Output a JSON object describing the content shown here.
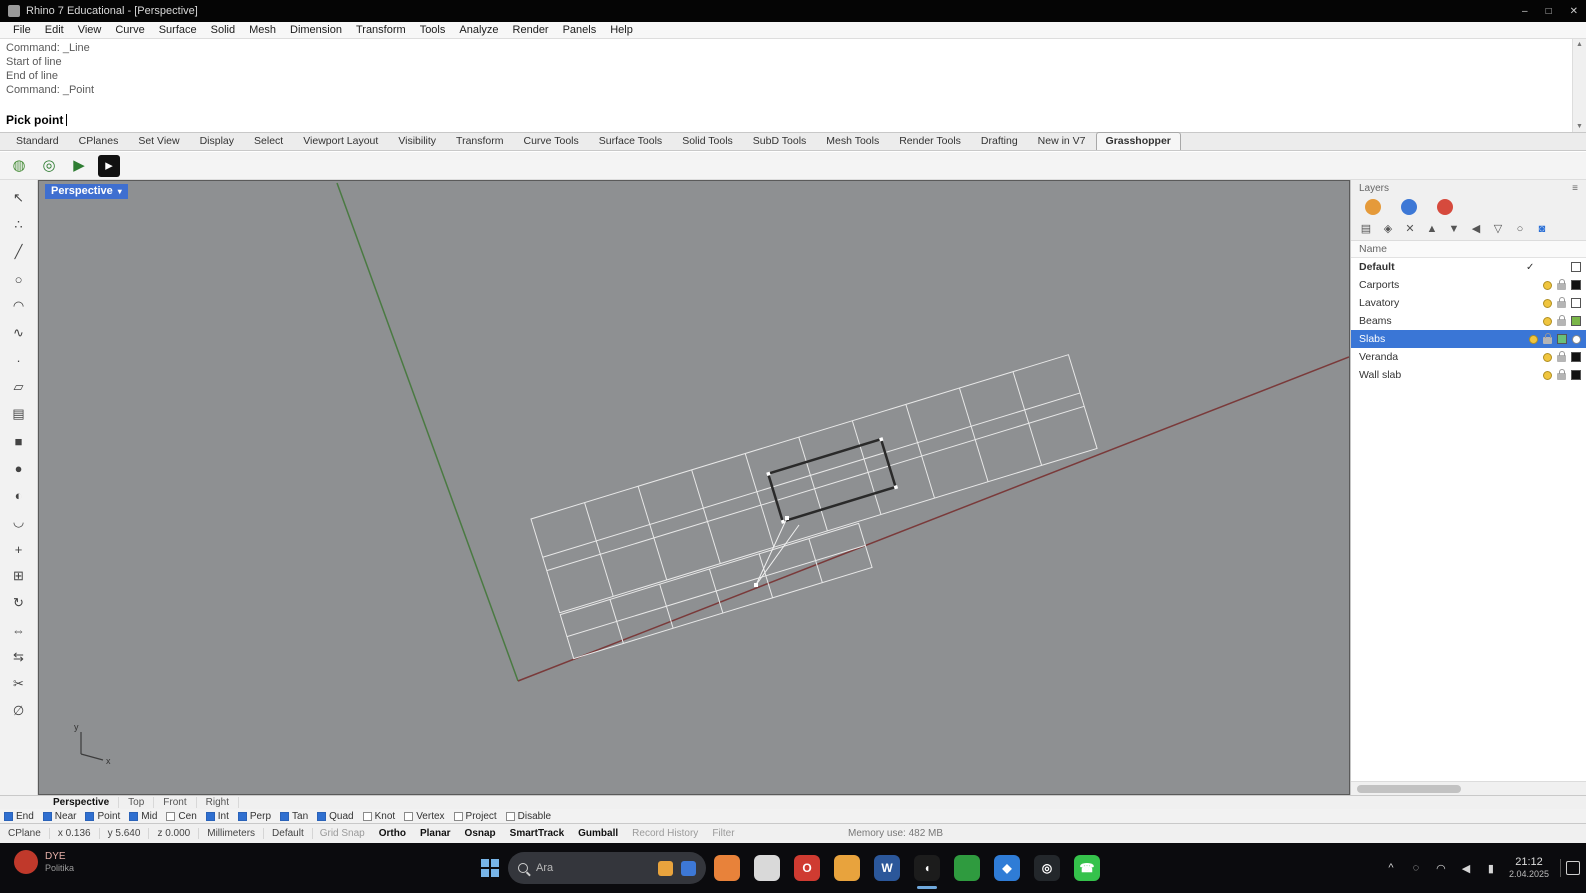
{
  "window": {
    "title": "Rhino 7 Educational - [Perspective]",
    "controls": {
      "minimize": "–",
      "maximize": "□",
      "close": "✕"
    }
  },
  "menubar": {
    "items": [
      "File",
      "Edit",
      "View",
      "Curve",
      "Surface",
      "Solid",
      "Mesh",
      "Dimension",
      "Transform",
      "Tools",
      "Analyze",
      "Render",
      "Panels",
      "Help"
    ]
  },
  "command": {
    "history": [
      "Command: _Line",
      "Start of line",
      "End of line",
      "Command: _Point"
    ],
    "prompt": "Pick point",
    "scrollbar": {
      "up": "▲",
      "down": "▼"
    }
  },
  "toolbar_tabs": {
    "items": [
      {
        "label": "Standard"
      },
      {
        "label": "CPlanes"
      },
      {
        "label": "Set View"
      },
      {
        "label": "Display"
      },
      {
        "label": "Select"
      },
      {
        "label": "Viewport Layout"
      },
      {
        "label": "Visibility"
      },
      {
        "label": "Transform"
      },
      {
        "label": "Curve Tools"
      },
      {
        "label": "Surface Tools"
      },
      {
        "label": "Solid Tools"
      },
      {
        "label": "SubD Tools"
      },
      {
        "label": "Mesh Tools"
      },
      {
        "label": "Render Tools"
      },
      {
        "label": "Drafting"
      },
      {
        "label": "New in V7"
      },
      {
        "label": "Grasshopper",
        "active": true
      }
    ]
  },
  "mini_toolbar": {
    "icons": [
      {
        "name": "grasshopper-launch-icon",
        "glyph": "◍",
        "color": "#4a8f3c"
      },
      {
        "name": "grasshopper-player-icon",
        "glyph": "◎",
        "color": "#2e7d32"
      },
      {
        "name": "play-icon",
        "glyph": "▶",
        "color": "#2e7d32"
      },
      {
        "name": "terminal-icon",
        "glyph": "▸",
        "color": "#ffffff",
        "bg": "#111111"
      }
    ]
  },
  "left_toolbar": {
    "tools": [
      {
        "name": "select-pointer-icon",
        "glyph": "↖"
      },
      {
        "name": "control-points-icon",
        "glyph": "∴"
      },
      {
        "name": "polyline-icon",
        "glyph": "╱"
      },
      {
        "name": "circle-icon",
        "glyph": "○"
      },
      {
        "name": "arc-icon",
        "glyph": "◠"
      },
      {
        "name": "curve-icon",
        "glyph": "∿"
      },
      {
        "name": "point-icon",
        "glyph": "·"
      },
      {
        "name": "surface-icon",
        "glyph": "▱"
      },
      {
        "name": "extrude-icon",
        "glyph": "▤"
      },
      {
        "name": "box-icon",
        "glyph": "■"
      },
      {
        "name": "sphere-icon",
        "glyph": "●"
      },
      {
        "name": "boolean-icon",
        "glyph": "◐"
      },
      {
        "name": "fillet-icon",
        "glyph": "◡"
      },
      {
        "name": "move-icon",
        "glyph": "+"
      },
      {
        "name": "copy-icon",
        "glyph": "⊞"
      },
      {
        "name": "rotate-icon",
        "glyph": "↻"
      },
      {
        "name": "scale-icon",
        "glyph": "⇔"
      },
      {
        "name": "mirror-icon",
        "glyph": "⇆"
      },
      {
        "name": "trim-icon",
        "glyph": "✂"
      },
      {
        "name": "hide-icon",
        "glyph": "∅"
      }
    ]
  },
  "viewport": {
    "label": "Perspective",
    "caret": "▾",
    "axis": {
      "x": "x",
      "y": "y"
    }
  },
  "layers_panel": {
    "title": "Layers",
    "menu_glyph": "≡",
    "tab_icons": [
      {
        "name": "render-sphere-icon",
        "color": "#e59a3a"
      },
      {
        "name": "notifications-bell-icon",
        "color": "#3d78d6"
      },
      {
        "name": "help-icon",
        "color": "#d64a3d"
      }
    ],
    "toolbar": [
      {
        "name": "new-layer-icon",
        "glyph": "▤",
        "color": "#555555"
      },
      {
        "name": "new-sublayer-icon",
        "glyph": "◈",
        "color": "#555555"
      },
      {
        "name": "delete-layer-icon",
        "glyph": "✕",
        "color": "#555555"
      },
      {
        "name": "move-up-icon",
        "glyph": "▲",
        "color": "#555555"
      },
      {
        "name": "move-down-icon",
        "glyph": "▼",
        "color": "#555555"
      },
      {
        "name": "collapse-icon",
        "glyph": "◀",
        "color": "#555555"
      },
      {
        "name": "filter-icon",
        "glyph": "▽",
        "color": "#555555"
      },
      {
        "name": "search-layers-icon",
        "glyph": "○",
        "color": "#555555"
      },
      {
        "name": "layer-settings-icon",
        "glyph": "◙",
        "color": "#2a6fd6"
      }
    ],
    "header": {
      "name": "Name"
    },
    "rows": [
      {
        "name": "Default",
        "current": true,
        "noicons": true,
        "color": "#ffffff"
      },
      {
        "name": "Carports",
        "color": "#111111"
      },
      {
        "name": "Lavatory",
        "color": "#ffffff"
      },
      {
        "name": "Beams",
        "color": "#7ab648"
      },
      {
        "name": "Slabs",
        "selected": true,
        "color": "#69c07a"
      },
      {
        "name": "Veranda",
        "color": "#111111"
      },
      {
        "name": "Wall slab",
        "color": "#111111"
      }
    ]
  },
  "viewport_tabs": {
    "items": [
      {
        "label": "Perspective",
        "active": true
      },
      {
        "label": "Top"
      },
      {
        "label": "Front"
      },
      {
        "label": "Right"
      }
    ]
  },
  "osnap": {
    "items": [
      {
        "label": "End",
        "checked": true
      },
      {
        "label": "Near",
        "checked": true
      },
      {
        "label": "Point",
        "checked": true
      },
      {
        "label": "Mid",
        "checked": true
      },
      {
        "label": "Cen",
        "checked": false
      },
      {
        "label": "Int",
        "checked": true
      },
      {
        "label": "Perp",
        "checked": true
      },
      {
        "label": "Tan",
        "checked": true
      },
      {
        "label": "Quad",
        "checked": true
      },
      {
        "label": "Knot",
        "checked": false
      },
      {
        "label": "Vertex",
        "checked": false
      },
      {
        "label": "Project",
        "checked": false
      },
      {
        "label": "Disable",
        "checked": false
      }
    ]
  },
  "status": {
    "cplane": "CPlane",
    "x": "x 0.136",
    "y": "y 5.640",
    "z": "z 0.000",
    "units": "Millimeters",
    "layer": "Default",
    "toggles": [
      {
        "label": "Grid Snap"
      },
      {
        "label": "Ortho",
        "active": true
      },
      {
        "label": "Planar",
        "active": true
      },
      {
        "label": "Osnap",
        "active": true
      },
      {
        "label": "SmartTrack",
        "active": true
      },
      {
        "label": "Gumball",
        "active": true
      },
      {
        "label": "Record History"
      },
      {
        "label": "Filter"
      }
    ],
    "right": "Memory use: 482 MB"
  },
  "taskbar": {
    "widget": {
      "title": "DYE",
      "subtitle": "Politika"
    },
    "search": {
      "placeholder": "Ara"
    },
    "apps": [
      {
        "name": "firefox-icon",
        "bg": "#e8823a",
        "glyph": "",
        "fg": "#ffffff"
      },
      {
        "name": "chat-icon",
        "bg": "#d9d9d9",
        "glyph": "",
        "fg": "#555555"
      },
      {
        "name": "opera-icon",
        "bg": "#cf3b31",
        "glyph": "O",
        "fg": "#ffffff"
      },
      {
        "name": "file-explorer-icon",
        "bg": "#e8a33d",
        "glyph": "",
        "fg": "#ffffff"
      },
      {
        "name": "word-icon",
        "bg": "#2b579a",
        "glyph": "W",
        "fg": "#ffffff"
      },
      {
        "name": "rhino-app-icon",
        "bg": "#1c1c1c",
        "glyph": "◖",
        "fg": "#ffffff",
        "active": true
      },
      {
        "name": "grasshopper-icon",
        "bg": "#2f9b3f",
        "glyph": "",
        "fg": "#ffffff"
      },
      {
        "name": "vscode-icon",
        "bg": "#2f7cd6",
        "glyph": "◆",
        "fg": "#ffffff"
      },
      {
        "name": "obs-icon",
        "bg": "#23272b",
        "glyph": "◎",
        "fg": "#ffffff"
      },
      {
        "name": "whatsapp-icon",
        "bg": "#35c24b",
        "glyph": "☎",
        "fg": "#ffffff"
      }
    ],
    "tray": {
      "icons": [
        {
          "name": "hidden-icons-chevron",
          "glyph": "^"
        },
        {
          "name": "mic-icon",
          "glyph": "◌"
        },
        {
          "name": "network-icon",
          "glyph": "◠"
        },
        {
          "name": "volume-icon",
          "glyph": "◀"
        },
        {
          "name": "battery-icon",
          "glyph": "▮"
        }
      ],
      "time": "21:12",
      "date": "2.04.2025"
    }
  }
}
